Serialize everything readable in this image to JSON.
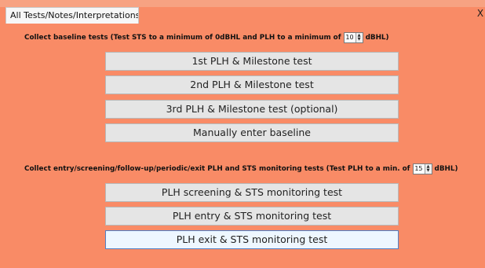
{
  "tab": {
    "label": "All Tests/Notes/Interpretations"
  },
  "close": {
    "label": "X"
  },
  "baseline": {
    "text_before": "Collect baseline tests (Test STS to a minimum of 0dBHL and PLH to a minimum of",
    "value": "10",
    "text_after": "dBHL)",
    "buttons": [
      "1st PLH & Milestone test",
      "2nd PLH & Milestone test",
      "3rd PLH & Milestone test (optional)",
      "Manually enter baseline"
    ]
  },
  "monitoring": {
    "text_before": "Collect entry/screening/follow-up/periodic/exit PLH and STS monitoring tests (Test PLH to a min. of",
    "value": "15",
    "text_after": "dBHL)",
    "buttons": [
      "PLH screening & STS monitoring test",
      "PLH entry & STS monitoring test",
      "PLH exit & STS monitoring test"
    ]
  },
  "spinner": {
    "up": "▲",
    "down": "▼"
  },
  "colors": {
    "panel_bg": "#f98b66",
    "button_bg": "#e5e5e5",
    "focus_bg": "#eef7ff",
    "focus_border": "#4f82c8"
  }
}
